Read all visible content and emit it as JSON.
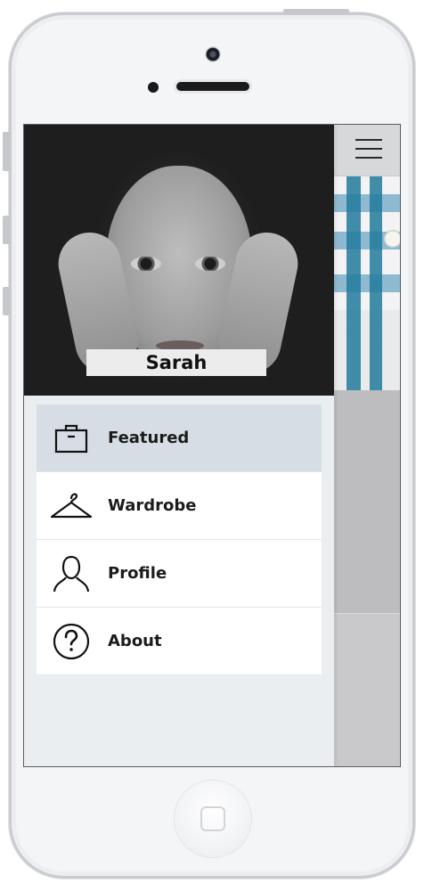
{
  "profile": {
    "name": "Sarah"
  },
  "menu": {
    "items": [
      {
        "label": "Featured",
        "icon": "briefcase-icon",
        "active": true
      },
      {
        "label": "Wardrobe",
        "icon": "hanger-icon",
        "active": false
      },
      {
        "label": "Profile",
        "icon": "person-icon",
        "active": false
      },
      {
        "label": "About",
        "icon": "question-circle-icon",
        "active": false
      }
    ]
  },
  "colors": {
    "active_item": "#d6dde4",
    "drawer_bg": "#ebeef1",
    "item_bg": "#ffffff"
  }
}
